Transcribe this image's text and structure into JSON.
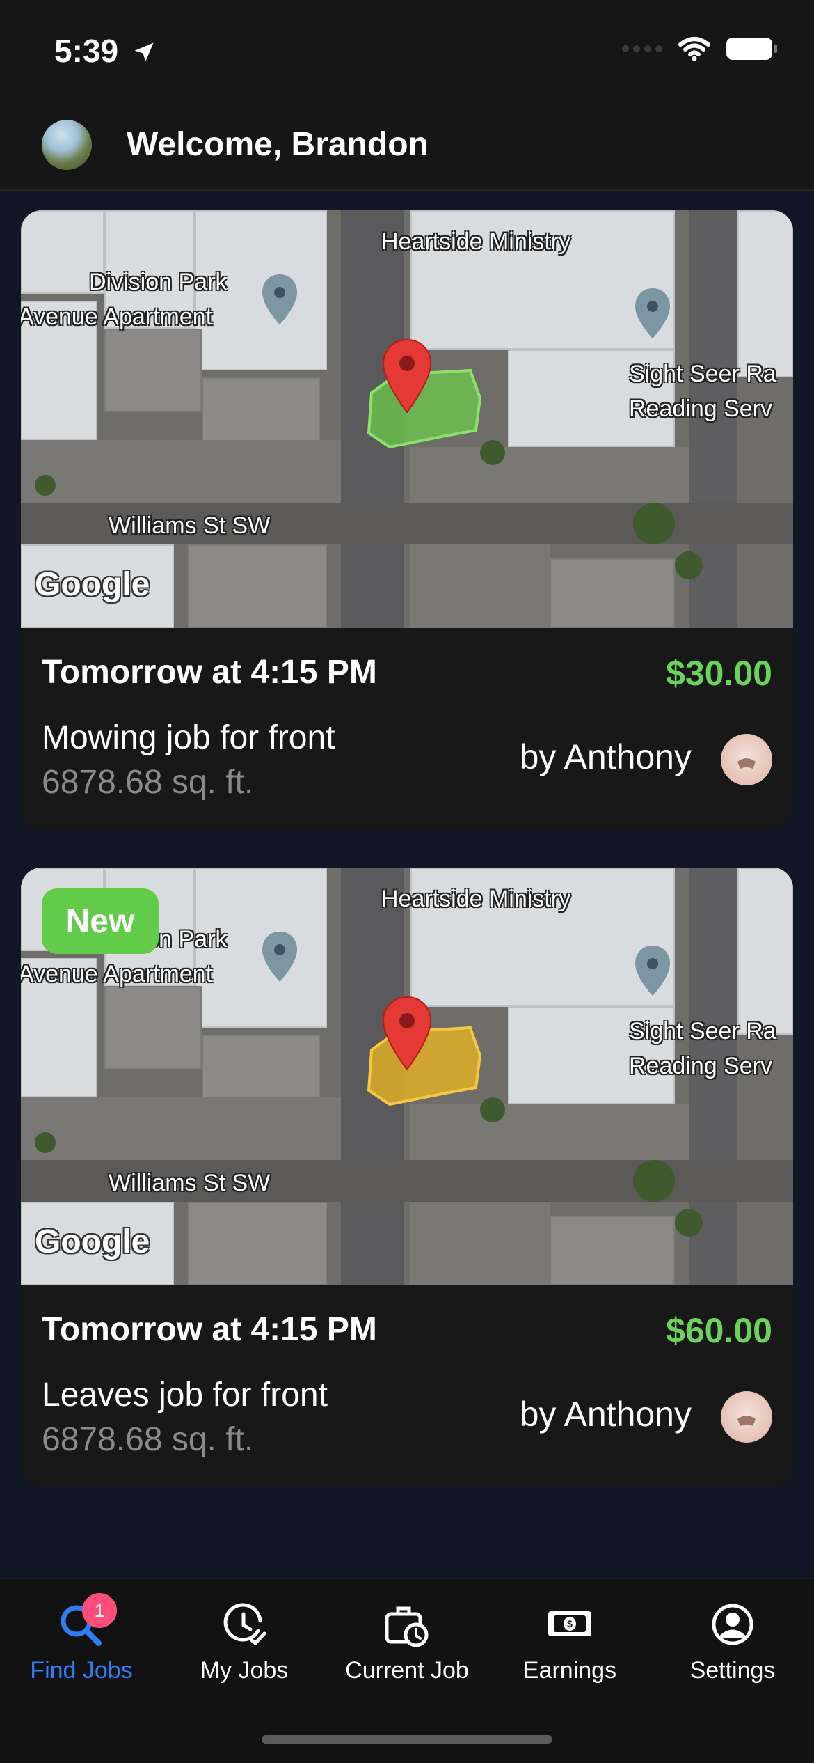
{
  "status_bar": {
    "time": "5:39"
  },
  "header": {
    "welcome": "Welcome, Brandon"
  },
  "map_labels": {
    "heartside": "Heartside Ministry",
    "division_park_1": "Division Park",
    "division_park_2": "Avenue Apartment",
    "sight_seer_1": "Sight Seer Ra",
    "sight_seer_2": "Reading Serv",
    "williams": "Williams St SW",
    "google": "Google"
  },
  "jobs": [
    {
      "when": "Tomorrow at 4:15 PM",
      "price": "$30.00",
      "description": "Mowing job for front",
      "area": "6878.68 sq. ft.",
      "by": "by Anthony",
      "polygon_color": "#6ccb4a",
      "is_new": false
    },
    {
      "when": "Tomorrow at 4:15 PM",
      "price": "$60.00",
      "description": "Leaves job for front",
      "area": "6878.68 sq. ft.",
      "by": "by Anthony",
      "polygon_color": "#e6b323",
      "is_new": true,
      "badge": "New"
    }
  ],
  "tabs": [
    {
      "label": "Find Jobs",
      "icon": "search-icon",
      "active": true,
      "badge": "1"
    },
    {
      "label": "My Jobs",
      "icon": "clock-check-icon",
      "active": false
    },
    {
      "label": "Current Job",
      "icon": "briefcase-clock-icon",
      "active": false
    },
    {
      "label": "Earnings",
      "icon": "cash-icon",
      "active": false
    },
    {
      "label": "Settings",
      "icon": "user-circle-icon",
      "active": false
    }
  ],
  "colors": {
    "accent_blue": "#2f7cf6",
    "price_green": "#6cd35a",
    "badge_pink": "#ff4d79",
    "new_green": "#62cc4a"
  }
}
